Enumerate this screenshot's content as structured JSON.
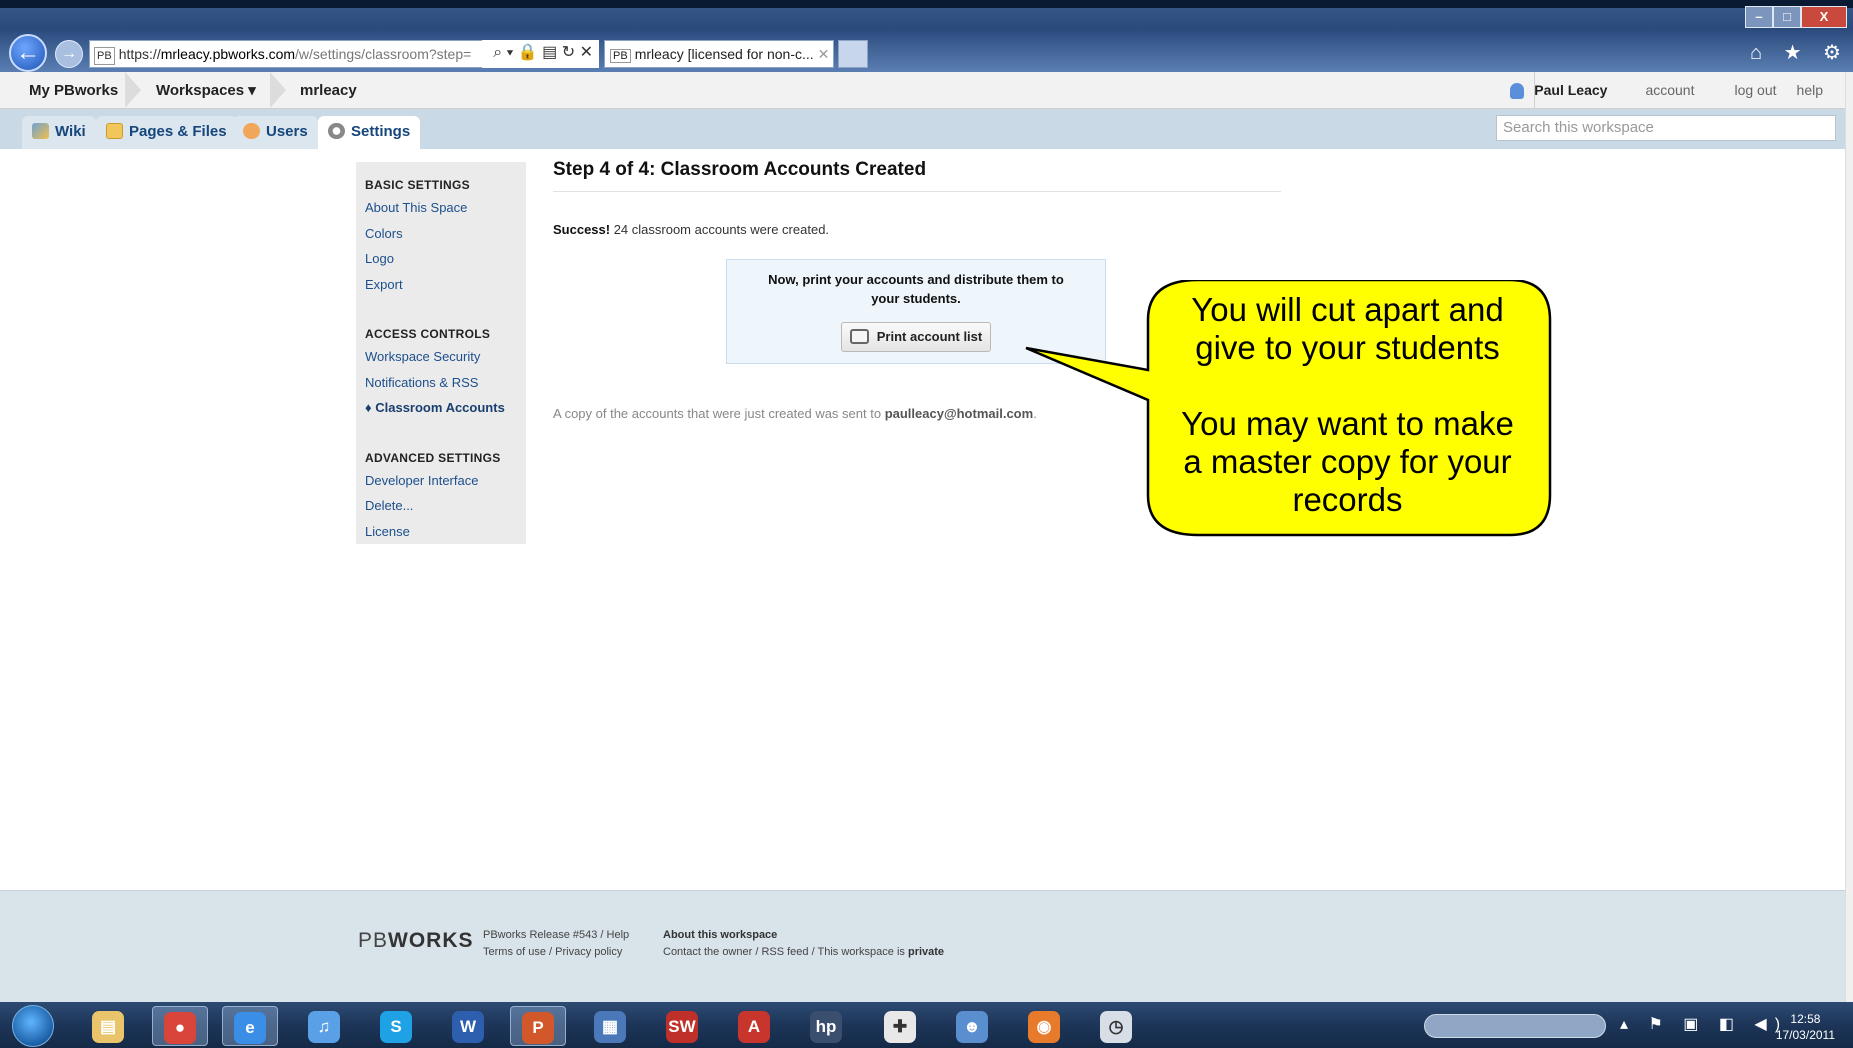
{
  "browser": {
    "url_favicon": "PB",
    "url_scheme": "https://",
    "url_host": "mrleacy.pbworks.com",
    "url_path": "/w/settings/classroom?step=",
    "url_icons": "⌕ ▾ 🔒 ▤ ↻ ✕",
    "tab_favicon": "PB",
    "tab_title": "mrleacy [licensed for non-c...",
    "tab_close": "✕",
    "win_min": "–",
    "win_max": "□",
    "win_close": "X",
    "toolbar_icons": "⌂ ★ ⚙"
  },
  "topbar": {
    "my_pbworks": "My PBworks",
    "workspaces": "Workspaces ▾",
    "workspace_name": "mrleacy",
    "user_name": "Paul Leacy",
    "account": "account",
    "logout": "log out",
    "help": "help"
  },
  "tabs": {
    "wiki": "Wiki",
    "pages_files": "Pages & Files",
    "users": "Users",
    "settings": "Settings"
  },
  "search": {
    "placeholder": "Search this workspace"
  },
  "sidebar": {
    "basic_heading": "BASIC SETTINGS",
    "about": "About This Space",
    "colors": "Colors",
    "logo": "Logo",
    "export": "Export",
    "access_heading": "ACCESS CONTROLS",
    "security": "Workspace Security",
    "notifications": "Notifications & RSS",
    "classroom": "♦ Classroom Accounts",
    "advanced_heading": "ADVANCED SETTINGS",
    "developer": "Developer Interface",
    "delete": "Delete...",
    "license": "License"
  },
  "main": {
    "title": "Step 4 of 4: Classroom Accounts Created",
    "success_label": "Success!",
    "success_text": " 24 classroom accounts were created.",
    "print_message": "Now, print your accounts and distribute them to your students.",
    "print_button": "Print account list",
    "copy_note_prefix": "A copy of the accounts that were just created was sent to ",
    "copy_note_email": "paulleacy@hotmail.com",
    "copy_note_suffix": "."
  },
  "callout": {
    "line1": "You will cut apart and",
    "line2": "give to your students",
    "line3": "You may want to make",
    "line4": "a master copy for your",
    "line5": "records",
    "fill": "#ffff00"
  },
  "footer": {
    "logo_pb": "PB",
    "logo_works": "WORKS",
    "release": "PBworks Release #543",
    "help": " / Help",
    "terms": "Terms of use",
    "privacy": " / Privacy policy",
    "about_heading": "About this workspace",
    "contact": "Contact the owner / RSS feed / This workspace is ",
    "private": "private"
  },
  "taskbar": {
    "icons": [
      "explorer-icon",
      "chrome-icon",
      "ie-icon",
      "itunes-icon",
      "skype-icon",
      "word-icon",
      "powerpoint-icon",
      "unknown-app-icon",
      "solidworks-icon",
      "autocad-icon",
      "hp-icon",
      "pdf-icon",
      "people-icon",
      "firefox-icon",
      "clock-app-icon"
    ],
    "time": "12:58",
    "date": "17/03/2011"
  }
}
